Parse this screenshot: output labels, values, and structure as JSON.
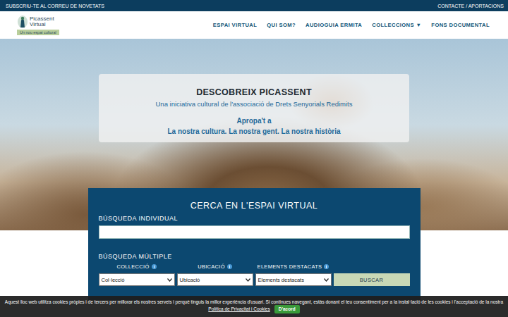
{
  "top_bar": {
    "subscribe": "SUBSCRIU-TE AL CORREU DE NOVETATS",
    "contact": "CONTACTE / APORTACIONS"
  },
  "logo": {
    "title": "Picassent",
    "subtitle": "Virtual",
    "tagline": "Un nou espai cultural"
  },
  "nav": [
    {
      "label": "ESPAI VIRTUAL"
    },
    {
      "label": "QUI SOM?"
    },
    {
      "label": "AUDIOGUIA ERMITA"
    },
    {
      "label": "COLLECCIONS ▼"
    },
    {
      "label": "FONS DOCUMENTAL"
    }
  ],
  "hero": {
    "title": "DESCOBREIX PICASSENT",
    "subtitle": "Una iniciativa cultural de l'associació de Drets Senyorials Redimits",
    "lead": "Apropa't a",
    "motto": "La nostra cultura. La nostra gent. La nostra història"
  },
  "search": {
    "title": "CERCA EN L'ESPAI VIRTUAL",
    "individual_label": "BÚSQUEDA INDIVIDUAL",
    "multiple_label": "BÚSQUEDA MÚLTIPLE",
    "filters": [
      {
        "label": "COLLECCIÓ",
        "value": "Col·lecció"
      },
      {
        "label": "UBICACIÓ",
        "value": "Ubicació"
      },
      {
        "label": "ELEMENTS DESTACATS",
        "value": "Elements destacats"
      }
    ],
    "button": "BUSCAR"
  },
  "cookie_bar": {
    "text": "Aquest lloc web utilitza cookies pròpies i de tercers per millorar els nostres serveis i perquè tinguis la millor experiència d'usuari. Si continues navegant, estàs donant el teu consentiment per a la instal·lació de les cookies i l'acceptació de la nostra",
    "link": "Política de Privacitat i Cookies",
    "button": "D'acord"
  }
}
